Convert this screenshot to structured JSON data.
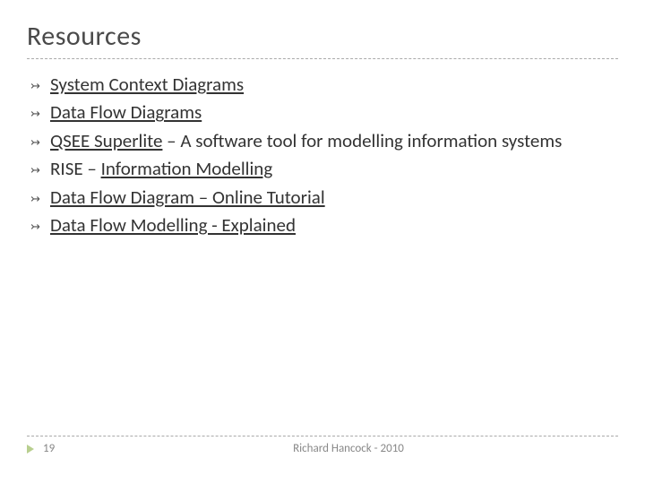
{
  "title": "Resources",
  "bullets": [
    {
      "link": "System Context Diagrams",
      "rest": ""
    },
    {
      "link": "Data Flow Diagrams",
      "rest": ""
    },
    {
      "link": "QSEE Superlite",
      "rest": " – A software tool for modelling information systems"
    },
    {
      "prefix": "RISE – ",
      "link": "Information Modelling",
      "rest": ""
    },
    {
      "link": "Data Flow Diagram – Online Tutorial",
      "rest": ""
    },
    {
      "link": "Data Flow Modelling - Explained",
      "rest": ""
    }
  ],
  "footer": {
    "page": "19",
    "author": "Richard Hancock - 2010"
  }
}
